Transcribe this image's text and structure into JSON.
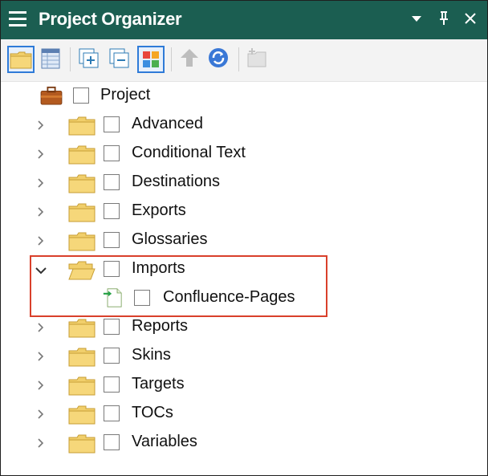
{
  "window": {
    "title": "Project Organizer",
    "controls": {
      "dropdown_icon": "triangle-down-icon",
      "pin_icon": "pin-icon",
      "close_icon": "close-icon"
    }
  },
  "toolbar": {
    "buttons": [
      {
        "name": "folder-view",
        "icon": "folder-icon",
        "active": true
      },
      {
        "name": "table-view",
        "icon": "table-icon",
        "active": false
      },
      {
        "name": "expand-all",
        "icon": "expand-all-icon",
        "active": false
      },
      {
        "name": "collapse-all",
        "icon": "collapse-all-icon",
        "active": false
      },
      {
        "name": "color-grid",
        "icon": "color-grid-icon",
        "active": true
      },
      {
        "name": "move-up",
        "icon": "up-arrow-icon",
        "active": false
      },
      {
        "name": "refresh",
        "icon": "refresh-icon",
        "active": false
      },
      {
        "name": "new-folder",
        "icon": "new-folder-icon",
        "active": false
      }
    ]
  },
  "tree": {
    "root": {
      "label": "Project",
      "icon": "briefcase-icon"
    },
    "items": [
      {
        "label": "Advanced",
        "expanded": false
      },
      {
        "label": "Conditional Text",
        "expanded": false
      },
      {
        "label": "Destinations",
        "expanded": false
      },
      {
        "label": "Exports",
        "expanded": false
      },
      {
        "label": "Glossaries",
        "expanded": false
      },
      {
        "label": "Imports",
        "expanded": true,
        "children": [
          {
            "label": "Confluence-Pages",
            "icon": "import-file-icon"
          }
        ]
      },
      {
        "label": "Reports",
        "expanded": false
      },
      {
        "label": "Skins",
        "expanded": false
      },
      {
        "label": "Targets",
        "expanded": false
      },
      {
        "label": "TOCs",
        "expanded": false
      },
      {
        "label": "Variables",
        "expanded": false
      }
    ]
  },
  "colors": {
    "titlebar": "#1b5e51",
    "highlight": "#d9402b",
    "folder": "#f6d77a",
    "active_button": "#2f7bd8"
  }
}
